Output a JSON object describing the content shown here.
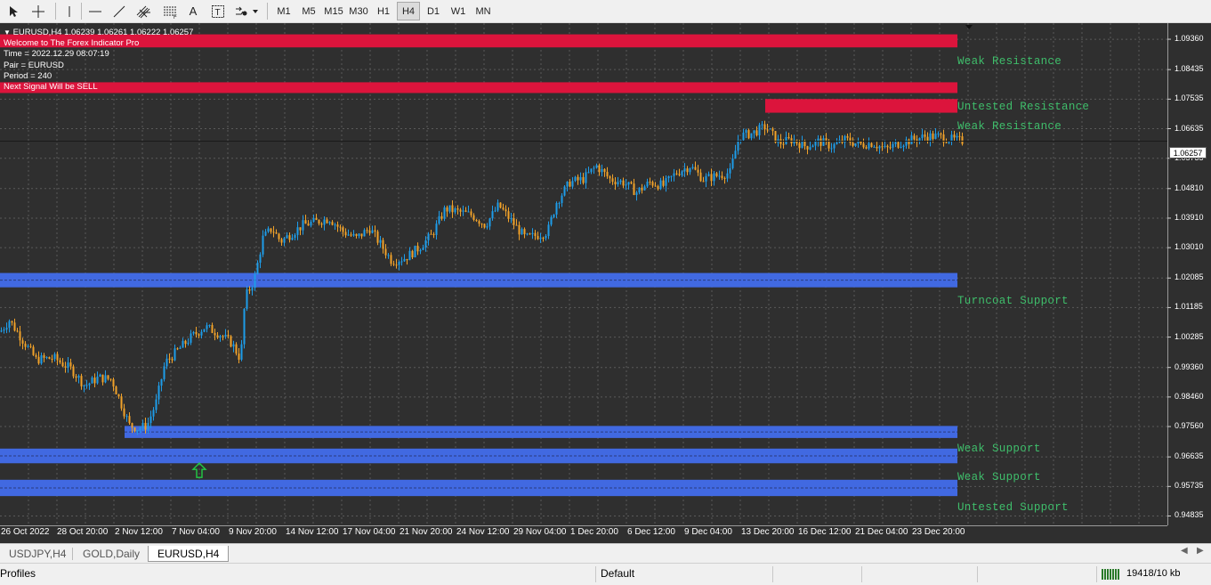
{
  "toolbar": {
    "tools": [
      {
        "name": "cursor-tool-button",
        "icon": "cursor-arrow-icon"
      },
      {
        "name": "crosshair-tool-button",
        "icon": "crosshair-icon"
      },
      {
        "name": "vertical-line-tool-button",
        "icon": "vertical-line-icon"
      },
      {
        "name": "horizontal-line-tool-button",
        "icon": "horizontal-line-icon"
      },
      {
        "name": "trendline-tool-button",
        "icon": "trendline-icon"
      },
      {
        "name": "channels-tool-button",
        "icon": "channel-icon"
      },
      {
        "name": "fibonacci-tool-button",
        "icon": "fibonacci-icon"
      },
      {
        "name": "text-tool-button",
        "icon": "text-icon",
        "label": "A"
      },
      {
        "name": "text-label-tool-button",
        "icon": "text-label-icon",
        "label": "T"
      },
      {
        "name": "shapes-tool-button",
        "icon": "shapes-dropdown-icon"
      }
    ],
    "timeframes": [
      "M1",
      "M5",
      "M15",
      "M30",
      "H1",
      "H4",
      "D1",
      "W1",
      "MN"
    ],
    "active_timeframe": "H4"
  },
  "chart": {
    "header": "EURUSD,H4  1.06239 1.06261 1.06222 1.06257",
    "info_lines": [
      "Welcome to The Forex Indicator Pro",
      "Time = 2022.12.29 08:07:19",
      "Pair = EURUSD",
      "Period = 240",
      "Next Signal Will be SELL"
    ],
    "current_price": "1.06257",
    "colors": {
      "background": "#2f2f2f",
      "grid": "#5a5a5a",
      "bull_candle": "#1e9ce8",
      "bear_candle": "#f0a22a",
      "resistance_zone": "#dc143c",
      "support_zone": "#4169e1",
      "zone_label": "#3fbe6b",
      "signal_arrow": "#22cc44"
    },
    "signal_arrow": {
      "direction": "up",
      "icon": "buy-arrow-icon"
    }
  },
  "chart_data": {
    "type": "candlestick",
    "symbol": "EURUSD",
    "timeframe": "H4",
    "y_ticks": [
      "1.09360",
      "1.08435",
      "1.07535",
      "1.06635",
      "1.05735",
      "1.04810",
      "1.03910",
      "1.03010",
      "1.02085",
      "1.01185",
      "1.00285",
      "0.99360",
      "0.98460",
      "0.97560",
      "0.96635",
      "0.95735",
      "0.94835"
    ],
    "x_ticks": [
      "26 Oct 2022",
      "28 Oct 20:00",
      "2 Nov 12:00",
      "7 Nov 04:00",
      "9 Nov 20:00",
      "14 Nov 12:00",
      "17 Nov 04:00",
      "21 Nov 20:00",
      "24 Nov 12:00",
      "29 Nov 04:00",
      "1 Dec 20:00",
      "6 Dec 12:00",
      "9 Dec 04:00",
      "13 Dec 20:00",
      "16 Dec 12:00",
      "21 Dec 04:00",
      "23 Dec 20:00"
    ],
    "ylim": [
      0.9455,
      1.0985
    ],
    "close_path": [
      [
        0,
        1.0045
      ],
      [
        10,
        1.008
      ],
      [
        20,
        1.004
      ],
      [
        40,
        0.996
      ],
      [
        60,
        0.9965
      ],
      [
        80,
        0.993
      ],
      [
        95,
        0.988
      ],
      [
        110,
        0.9905
      ],
      [
        125,
        0.99
      ],
      [
        135,
        0.983
      ],
      [
        145,
        0.976
      ],
      [
        155,
        0.975
      ],
      [
        165,
        0.976
      ],
      [
        175,
        0.983
      ],
      [
        185,
        0.995
      ],
      [
        200,
        0.999
      ],
      [
        215,
        1.003
      ],
      [
        230,
        1.006
      ],
      [
        245,
        1.004
      ],
      [
        260,
        1.001
      ],
      [
        270,
        0.996
      ],
      [
        275,
        1.015
      ],
      [
        285,
        1.02
      ],
      [
        295,
        1.033
      ],
      [
        305,
        1.036
      ],
      [
        315,
        1.032
      ],
      [
        325,
        1.034
      ],
      [
        340,
        1.037
      ],
      [
        355,
        1.038
      ],
      [
        370,
        1.039
      ],
      [
        385,
        1.035
      ],
      [
        400,
        1.033
      ],
      [
        415,
        1.036
      ],
      [
        430,
        1.03
      ],
      [
        440,
        1.026
      ],
      [
        455,
        1.027
      ],
      [
        470,
        1.03
      ],
      [
        485,
        1.034
      ],
      [
        500,
        1.042
      ],
      [
        515,
        1.041
      ],
      [
        530,
        1.04
      ],
      [
        545,
        1.037
      ],
      [
        560,
        1.043
      ],
      [
        575,
        1.038
      ],
      [
        590,
        1.033
      ],
      [
        605,
        1.034
      ],
      [
        615,
        1.035
      ],
      [
        625,
        1.044
      ],
      [
        640,
        1.05
      ],
      [
        655,
        1.051
      ],
      [
        670,
        1.055
      ],
      [
        685,
        1.051
      ],
      [
        700,
        1.05
      ],
      [
        715,
        1.047
      ],
      [
        730,
        1.05
      ],
      [
        745,
        1.049
      ],
      [
        760,
        1.053
      ],
      [
        775,
        1.055
      ],
      [
        790,
        1.051
      ],
      [
        805,
        1.052
      ],
      [
        820,
        1.053
      ],
      [
        830,
        1.064
      ],
      [
        845,
        1.065
      ],
      [
        860,
        1.067
      ],
      [
        875,
        1.062
      ],
      [
        890,
        1.063
      ],
      [
        905,
        1.061
      ],
      [
        920,
        1.0625
      ],
      [
        935,
        1.061
      ],
      [
        950,
        1.063
      ],
      [
        965,
        1.0615
      ],
      [
        980,
        1.062
      ],
      [
        995,
        1.06
      ],
      [
        1010,
        1.062
      ],
      [
        1025,
        1.063
      ],
      [
        1040,
        1.064
      ],
      [
        1055,
        1.064
      ],
      [
        1070,
        1.063
      ],
      [
        1082,
        1.06257
      ]
    ],
    "zones": [
      {
        "type": "resistance",
        "label": "Weak Resistance",
        "high": 1.094,
        "low": 1.0922,
        "x_start": 0
      },
      {
        "type": "resistance",
        "label": "Untested Resistance",
        "high": 1.0794,
        "low": 1.0783,
        "x_start": 0
      },
      {
        "type": "resistance",
        "label": "Weak Resistance",
        "high": 1.0743,
        "low": 1.0723,
        "x_start": 860
      },
      {
        "type": "support",
        "label": "Turncoat Support",
        "high": 1.0213,
        "low": 1.0191,
        "x_start": 0
      },
      {
        "type": "support",
        "label": "Weak Support",
        "high": 0.9747,
        "low": 0.9732,
        "x_start": 140
      },
      {
        "type": "support",
        "label": "Untested Support",
        "high": 0.9678,
        "low": 0.9655,
        "x_start": 0,
        "label_override": "Weak Support"
      },
      {
        "type": "support",
        "label": "Untested Support",
        "high": 0.9583,
        "low": 0.9555,
        "x_start": 0
      }
    ],
    "zone_labels": [
      "Weak Resistance",
      "Untested Resistance",
      "Weak Resistance",
      "Turncoat Support",
      "Weak Support",
      "Weak Support",
      "Untested Support"
    ]
  },
  "tabs": {
    "items": [
      "USDJPY,H4",
      "GOLD,Daily",
      "EURUSD,H4"
    ],
    "active": "EURUSD,H4"
  },
  "status_bar": {
    "profiles": "Profiles",
    "profile_name": "Default",
    "traffic": "19418/10 kb",
    "connection_icon": "connection-bars-icon"
  }
}
